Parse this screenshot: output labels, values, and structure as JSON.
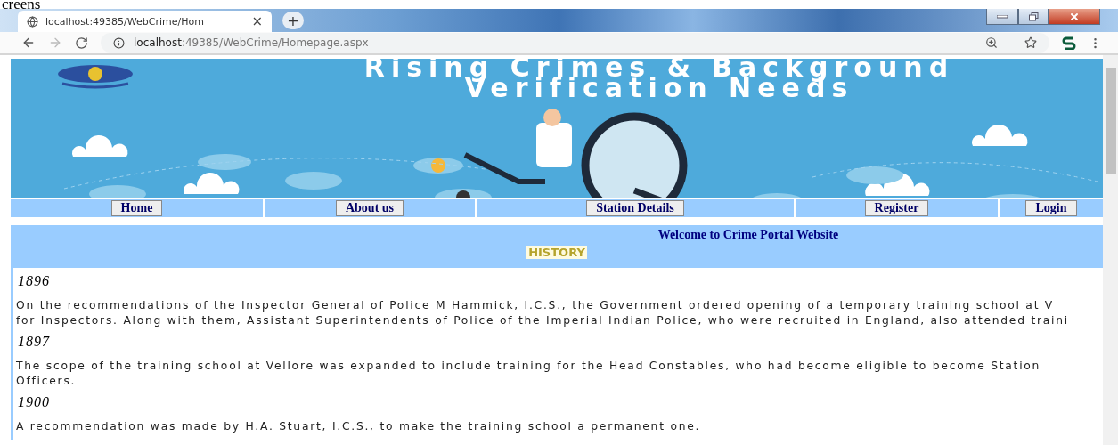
{
  "caption": "creens",
  "browser": {
    "tab": {
      "title": "localhost:49385/WebCrime/Hom",
      "close": "×"
    },
    "new_tab": "+",
    "address": {
      "host": "localhost",
      "path": ":49385/WebCrime/Homepage.aspx"
    }
  },
  "banner": {
    "title_lines": [
      "Rising Crimes & Background",
      "Verification Needs"
    ]
  },
  "nav": [
    {
      "label": "Home"
    },
    {
      "label": "About us"
    },
    {
      "label": "Station Details"
    },
    {
      "label": "Register"
    },
    {
      "label": "Login"
    }
  ],
  "welcome": "Welcome to Crime Portal Website",
  "section_title": "HISTORY",
  "entries": [
    {
      "year": "1896",
      "lines": [
        "On the recommendations of the Inspector General of Police M Hammick, I.C.S., the Government ordered opening of a temporary training school at V",
        "for Inspectors. Along with them, Assistant Superintendents of Police of the Imperial Indian Police, who were recruited in England, also attended traini"
      ]
    },
    {
      "year": "1897",
      "lines": [
        "The scope of the training school at Vellore was expanded to include training for the Head Constables, who had become eligible to become Station",
        "Officers."
      ]
    },
    {
      "year": "1900",
      "lines": [
        "A recommendation was made by H.A. Stuart, I.C.S., to make the training school a permanent one."
      ]
    }
  ]
}
